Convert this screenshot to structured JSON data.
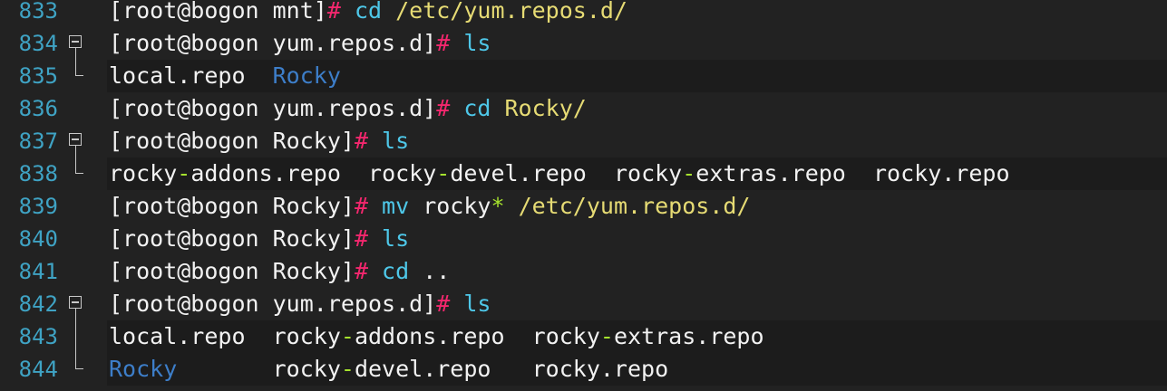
{
  "colors": {
    "background": "#222222",
    "highlight": "#1c1c1c",
    "line_number": "#3fa3c4",
    "text": "#f2f2f2",
    "prompt_hash": "#f4276e",
    "command": "#4ec7e8",
    "path": "#e6db74",
    "directory": "#3d7ec9",
    "dash": "#a6e22e"
  },
  "lines": [
    {
      "num": "833",
      "fold": "none",
      "highlight": false
    },
    {
      "num": "834",
      "fold": "start",
      "highlight": false
    },
    {
      "num": "835",
      "fold": "end",
      "highlight": true
    },
    {
      "num": "836",
      "fold": "none",
      "highlight": false
    },
    {
      "num": "837",
      "fold": "start",
      "highlight": false
    },
    {
      "num": "838",
      "fold": "end",
      "highlight": true
    },
    {
      "num": "839",
      "fold": "none",
      "highlight": false
    },
    {
      "num": "840",
      "fold": "none",
      "highlight": false
    },
    {
      "num": "841",
      "fold": "none",
      "highlight": false
    },
    {
      "num": "842",
      "fold": "start",
      "highlight": false
    },
    {
      "num": "843",
      "fold": "mid",
      "highlight": true
    },
    {
      "num": "844",
      "fold": "end",
      "highlight": true
    }
  ],
  "text": {
    "l833": {
      "prompt": "[root@bogon mnt]",
      "hash": "#",
      "cmd": " cd",
      "arg": " /etc/yum.repos.d/"
    },
    "l834": {
      "prompt": "[root@bogon yum.repos.d]",
      "hash": "#",
      "cmd": " ls"
    },
    "l835": {
      "file1": "local.repo",
      "sep1": "  ",
      "dir1": "Rocky"
    },
    "l836": {
      "prompt": "[root@bogon yum.repos.d]",
      "hash": "#",
      "cmd": " cd",
      "arg": " Rocky/"
    },
    "l837": {
      "prompt": "[root@bogon Rocky]",
      "hash": "#",
      "cmd": " ls"
    },
    "l838": {
      "f1a": "rocky",
      "f1d": "-",
      "f1b": "addons.repo",
      "s1": "  ",
      "f2a": "rocky",
      "f2d": "-",
      "f2b": "devel.repo",
      "s2": "  ",
      "f3a": "rocky",
      "f3d": "-",
      "f3b": "extras.repo",
      "s3": "  ",
      "f4": "rocky.repo"
    },
    "l839": {
      "prompt": "[root@bogon Rocky]",
      "hash": "#",
      "cmd": " mv",
      "arg1": " rocky",
      "star": "*",
      "arg2": " /etc/yum.repos.d/"
    },
    "l840": {
      "prompt": "[root@bogon Rocky]",
      "hash": "#",
      "cmd": " ls"
    },
    "l841": {
      "prompt": "[root@bogon Rocky]",
      "hash": "#",
      "cmd": " cd",
      "arg": " .."
    },
    "l842": {
      "prompt": "[root@bogon yum.repos.d]",
      "hash": "#",
      "cmd": " ls"
    },
    "l843": {
      "f1": "local.repo",
      "s1": "  ",
      "f2a": "rocky",
      "f2d": "-",
      "f2b": "addons.repo",
      "s2": "  ",
      "f3a": "rocky",
      "f3d": "-",
      "f3b": "extras.repo"
    },
    "l844": {
      "d1": "Rocky",
      "s1": "       ",
      "f2a": "rocky",
      "f2d": "-",
      "f2b": "devel.repo",
      "s2": "   ",
      "f3": "rocky.repo"
    }
  }
}
